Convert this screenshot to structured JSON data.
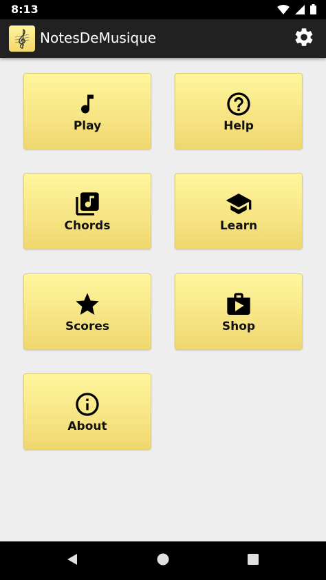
{
  "status_bar": {
    "time": "8:13",
    "icons": [
      "wifi-icon",
      "cell-signal-icon",
      "battery-icon"
    ]
  },
  "app_bar": {
    "title": "NotesDeMusique",
    "logo_icon": "treble-clef-icon",
    "settings_icon": "gear-icon"
  },
  "menu": {
    "items": [
      {
        "label": "Play",
        "icon": "music-note-icon"
      },
      {
        "label": "Help",
        "icon": "help-circle-icon"
      },
      {
        "label": "Chords",
        "icon": "music-library-icon"
      },
      {
        "label": "Learn",
        "icon": "graduation-cap-icon"
      },
      {
        "label": "Scores",
        "icon": "star-icon"
      },
      {
        "label": "Shop",
        "icon": "shop-bag-icon"
      },
      {
        "label": "About",
        "icon": "info-icon"
      }
    ]
  },
  "nav_bar": {
    "icons": [
      "back-icon",
      "home-icon",
      "recents-icon"
    ]
  },
  "colors": {
    "tile": "#fff59d",
    "app_bar": "#212121",
    "background": "#eeeeee"
  }
}
